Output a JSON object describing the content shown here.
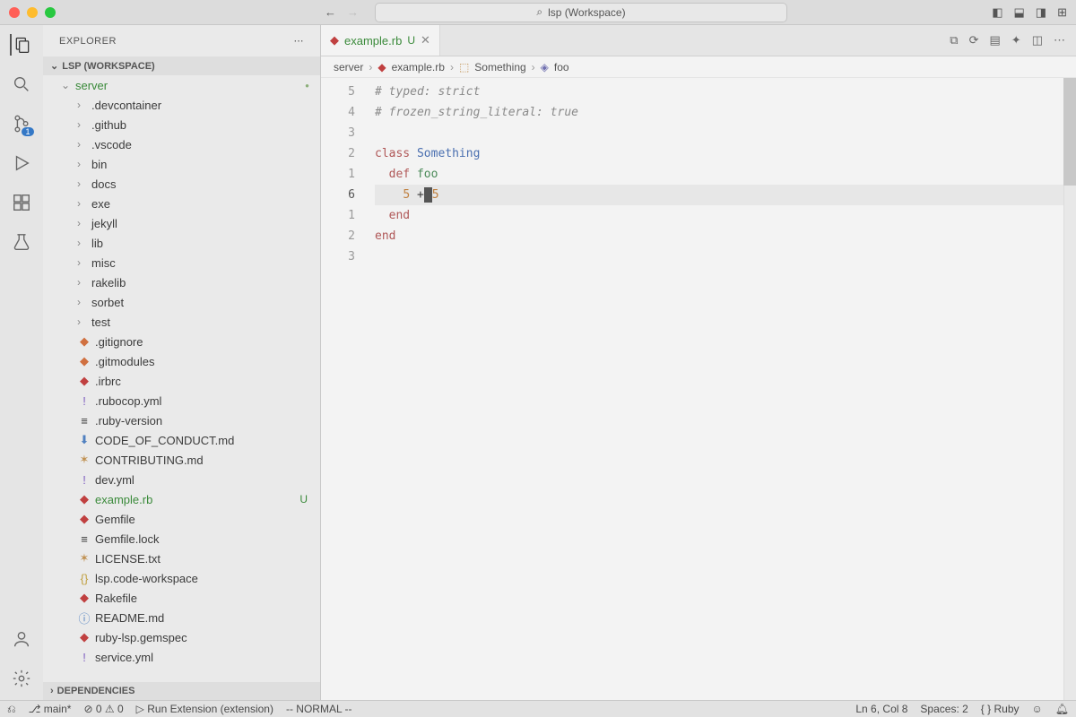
{
  "title": {
    "search_label": "lsp (Workspace)"
  },
  "sidebar": {
    "header": "EXPLORER",
    "workspace_label": "LSP (WORKSPACE)",
    "root": "server",
    "deps_label": "DEPENDENCIES",
    "folders": [
      ".devcontainer",
      ".github",
      ".vscode",
      "bin",
      "docs",
      "exe",
      "jekyll",
      "lib",
      "misc",
      "rakelib",
      "sorbet",
      "test"
    ],
    "files": [
      {
        "n": ".gitignore",
        "ico": "◆",
        "cls": "ico-git"
      },
      {
        "n": ".gitmodules",
        "ico": "◆",
        "cls": "ico-git"
      },
      {
        "n": ".irbrc",
        "ico": "◆",
        "cls": "ico-ruby"
      },
      {
        "n": ".rubocop.yml",
        "ico": "!",
        "cls": "ico-yml"
      },
      {
        "n": ".ruby-version",
        "ico": "≡",
        "cls": ""
      },
      {
        "n": "CODE_OF_CONDUCT.md",
        "ico": "⬇",
        "cls": "ico-md"
      },
      {
        "n": "CONTRIBUTING.md",
        "ico": "✶",
        "cls": "ico-txt"
      },
      {
        "n": "dev.yml",
        "ico": "!",
        "cls": "ico-yml"
      },
      {
        "n": "example.rb",
        "ico": "◆",
        "cls": "ico-ruby",
        "sel": true,
        "status": "U"
      },
      {
        "n": "Gemfile",
        "ico": "◆",
        "cls": "ico-ruby"
      },
      {
        "n": "Gemfile.lock",
        "ico": "≡",
        "cls": ""
      },
      {
        "n": "LICENSE.txt",
        "ico": "✶",
        "cls": "ico-txt"
      },
      {
        "n": "lsp.code-workspace",
        "ico": "{}",
        "cls": "ico-json"
      },
      {
        "n": "Rakefile",
        "ico": "◆",
        "cls": "ico-ruby"
      },
      {
        "n": "README.md",
        "ico": "ⓘ",
        "cls": "ico-info"
      },
      {
        "n": "ruby-lsp.gemspec",
        "ico": "◆",
        "cls": "ico-ruby"
      },
      {
        "n": "service.yml",
        "ico": "!",
        "cls": "ico-yml"
      }
    ]
  },
  "tab": {
    "name": "example.rb",
    "mod": "U"
  },
  "breadcrumbs": [
    "server",
    "example.rb",
    "Something",
    "foo"
  ],
  "gutter": [
    "5",
    "4",
    "3",
    "2",
    "1",
    "6",
    "1",
    "2",
    "3"
  ],
  "code": {
    "l1_comment": "# typed: strict",
    "l2_comment": "# frozen_string_literal: true",
    "kw_class": "class",
    "cls_name": "Something",
    "kw_def": "def",
    "fn_name": "foo",
    "n1": "5",
    "op": "+",
    "n2": "5",
    "kw_end1": "end",
    "kw_end2": "end"
  },
  "status": {
    "branch": "main*",
    "err": "0",
    "warn": "0",
    "run": "Run Extension (extension)",
    "mode": "-- NORMAL --",
    "pos": "Ln 6, Col 8",
    "spaces": "Spaces: 2",
    "lang": "Ruby"
  },
  "scm_badge": "1"
}
